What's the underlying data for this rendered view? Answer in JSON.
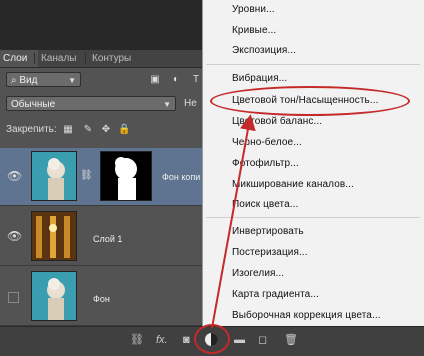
{
  "panel": {
    "tabs": [
      "Слои",
      "Каналы",
      "Контуры"
    ],
    "filter_value": "Вид",
    "blend_mode": "Обычные",
    "opacity_label_partial": "Не",
    "lock_label": "Закрепить:"
  },
  "layers": [
    {
      "name": "Фон копи",
      "selected": true,
      "visible": true
    },
    {
      "name": "Слой 1",
      "selected": false,
      "visible": true
    },
    {
      "name": "Фон",
      "selected": false,
      "visible": false
    }
  ],
  "bottom_bar": {
    "fx_label": "fx."
  },
  "menu": {
    "items": [
      "Уровни...",
      "Кривые...",
      "Экспозиция...",
      "Вибрация...",
      "Цветовой тон/Насыщенность...",
      "Цветовой баланс...",
      "Черно-белое...",
      "Фотофильтр...",
      "Микширование каналов...",
      "Поиск цвета...",
      "Инвертировать",
      "Постеризация...",
      "Изогелия...",
      "Карта градиента...",
      "Выборочная коррекция цвета..."
    ],
    "highlighted_index": 4
  },
  "annotation_color": "#c42a2a"
}
